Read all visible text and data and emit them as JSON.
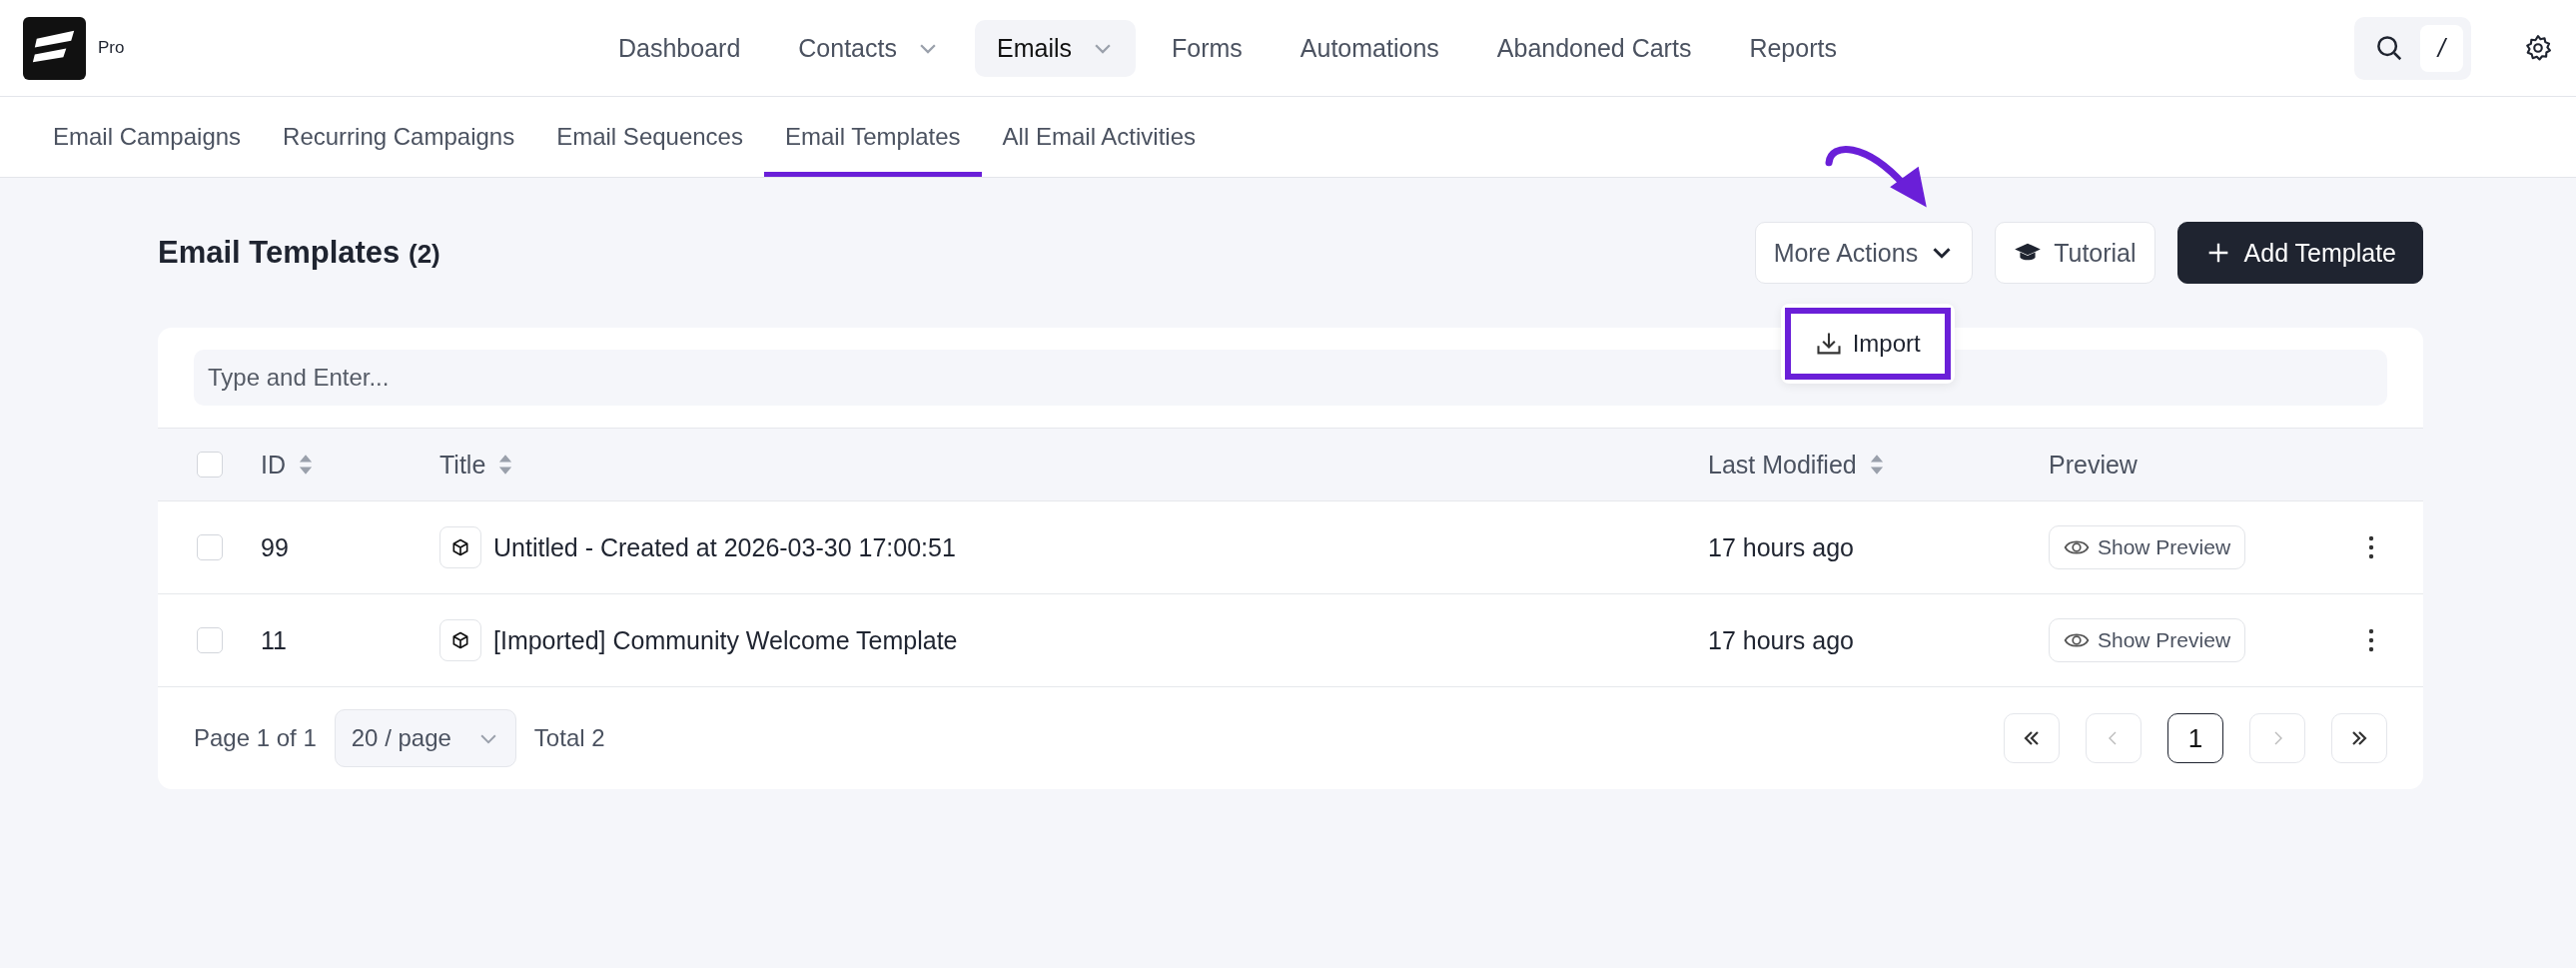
{
  "brand": {
    "badge": "Pro"
  },
  "nav": [
    {
      "label": "Dashboard",
      "selected": false,
      "dropdown": false
    },
    {
      "label": "Contacts",
      "selected": false,
      "dropdown": true
    },
    {
      "label": "Emails",
      "selected": true,
      "dropdown": true
    },
    {
      "label": "Forms",
      "selected": false,
      "dropdown": false
    },
    {
      "label": "Automations",
      "selected": false,
      "dropdown": false
    },
    {
      "label": "Abandoned Carts",
      "selected": false,
      "dropdown": false
    },
    {
      "label": "Reports",
      "selected": false,
      "dropdown": false
    }
  ],
  "search_shortcut": "/",
  "subnav": [
    {
      "label": "Email Campaigns",
      "selected": false
    },
    {
      "label": "Recurring Campaigns",
      "selected": false
    },
    {
      "label": "Email Sequences",
      "selected": false
    },
    {
      "label": "Email Templates",
      "selected": true
    },
    {
      "label": "All Email Activities",
      "selected": false
    }
  ],
  "page": {
    "title": "Email Templates",
    "count": "(2)"
  },
  "actions": {
    "more": "More Actions",
    "tutorial": "Tutorial",
    "add": "Add Template"
  },
  "menu": [
    {
      "label": "Import",
      "highlighted": true
    }
  ],
  "search": {
    "placeholder": "Type and Enter..."
  },
  "table": {
    "columns": [
      {
        "label": "ID",
        "sortable": true
      },
      {
        "label": "Title",
        "sortable": true
      },
      {
        "label": "Last Modified",
        "sortable": true
      },
      {
        "label": "Preview",
        "sortable": false
      }
    ],
    "rows": [
      {
        "checked": false,
        "id": "99",
        "title": "Untitled - Created at 2026-03-30 17:00:51",
        "modified": "17 hours ago",
        "preview": "Show Preview"
      },
      {
        "checked": false,
        "id": "11",
        "title": "[Imported] Community Welcome Template",
        "modified": "17 hours ago",
        "preview": "Show Preview"
      }
    ],
    "all_checked": false
  },
  "pagination": {
    "page_info": "Page 1 of 1",
    "per_page": "20 / page",
    "total": "Total 2",
    "pages": [
      {
        "label": "1",
        "selected": true
      }
    ]
  }
}
